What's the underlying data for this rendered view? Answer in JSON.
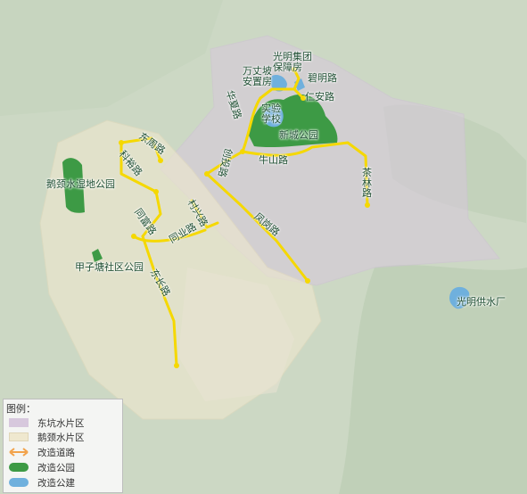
{
  "colors": {
    "base_green": "#c9d6c1",
    "dongkeng_zone": "#d7c8dd",
    "hejing_zone": "#efe8cf",
    "road": "#f5d800",
    "road_legend": "#f2a24a",
    "park": "#3d9a45",
    "building": "#6fb0dd"
  },
  "labels": {
    "wanzhangpo": "万丈坡\n安置房",
    "guangming_group": "光明集团\n保障房",
    "biming": "碧明路",
    "renan": "仁安路",
    "huaxia": "华夏路",
    "shiyan": "实验\n学校",
    "xincheng_park": "新城公园",
    "niushan": "牛山路",
    "chuangtou": "创投路",
    "chalin": "茶\n林\n路",
    "dongzhou": "东周路",
    "keyuan": "科裕路",
    "heshui_park": "鹅颈水湿地公园",
    "tongpi": "同富路",
    "cunxing": "村兴路",
    "tongye": "同业路",
    "fengchan": "凤岗路",
    "jiazitang_park": "甲子塘社区公园",
    "donghuan": "东长路",
    "water_plant": "光明供水厂"
  },
  "legend": {
    "title": "图例：",
    "items": [
      {
        "label": "东坑水片区",
        "kind": "zone",
        "color": "#d7c8dd"
      },
      {
        "label": "鹅颈水片区",
        "kind": "zone",
        "color": "#efe8cf"
      },
      {
        "label": "改造道路",
        "kind": "road",
        "color": "#f2a24a"
      },
      {
        "label": "改造公园",
        "kind": "park",
        "color": "#3d9a45"
      },
      {
        "label": "改造公建",
        "kind": "building",
        "color": "#6fb0dd"
      }
    ]
  }
}
